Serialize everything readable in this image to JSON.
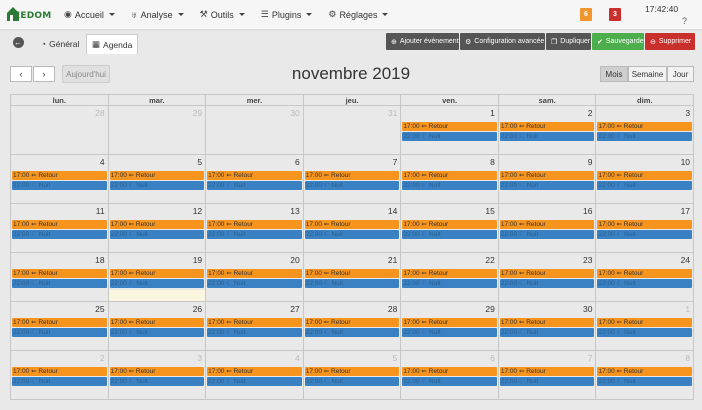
{
  "nav": {
    "logo_text": "EEDOM",
    "items": [
      {
        "label": "Accueil",
        "icon": "dashboard-icon"
      },
      {
        "label": "Analyse",
        "icon": "stethoscope-icon"
      },
      {
        "label": "Outils",
        "icon": "wrench-icon"
      },
      {
        "label": "Plugins",
        "icon": "list-icon"
      },
      {
        "label": "Réglages",
        "icon": "gear-icon"
      }
    ],
    "badge_orange": "6",
    "badge_red": "3",
    "clock": "17:42:40",
    "help": "?"
  },
  "toolbar": {
    "tab_general": "Général",
    "tab_agenda": "Agenda",
    "btn_add": "Ajouter événement",
    "btn_config": "Configuration avancée",
    "btn_dup": "Dupliquer",
    "btn_save": "Sauvegarder",
    "btn_delete": "Supprimer"
  },
  "colors": {
    "orange": "#f7941d",
    "blue": "#3a81c4",
    "save": "#4cae4c",
    "delete": "#c9302c",
    "dark_btn": "#555555"
  },
  "calendar": {
    "title": "novembre 2019",
    "today_label": "Aujourd'hui",
    "prev": "‹",
    "next": "›",
    "views": [
      "Mois",
      "Semaine",
      "Jour"
    ],
    "active_view": "Mois",
    "dow": [
      "lun.",
      "mar.",
      "mer.",
      "jeu.",
      "ven.",
      "sam.",
      "dim."
    ],
    "event_orange": "17:00 ⇐ Retour",
    "event_blue": "22:00 ☾ Nuit",
    "weeks": [
      {
        "days": [
          "28",
          "29",
          "30",
          "31",
          "1",
          "2",
          "3"
        ]
      },
      {
        "days": [
          "4",
          "5",
          "6",
          "7",
          "8",
          "9",
          "10"
        ]
      },
      {
        "days": [
          "11",
          "12",
          "13",
          "14",
          "15",
          "16",
          "17"
        ]
      },
      {
        "days": [
          "18",
          "19",
          "20",
          "21",
          "22",
          "23",
          "24"
        ]
      },
      {
        "days": [
          "25",
          "26",
          "27",
          "28",
          "29",
          "30",
          "1"
        ]
      },
      {
        "days": [
          "2",
          "3",
          "4",
          "5",
          "6",
          "7",
          "8"
        ]
      }
    ]
  }
}
